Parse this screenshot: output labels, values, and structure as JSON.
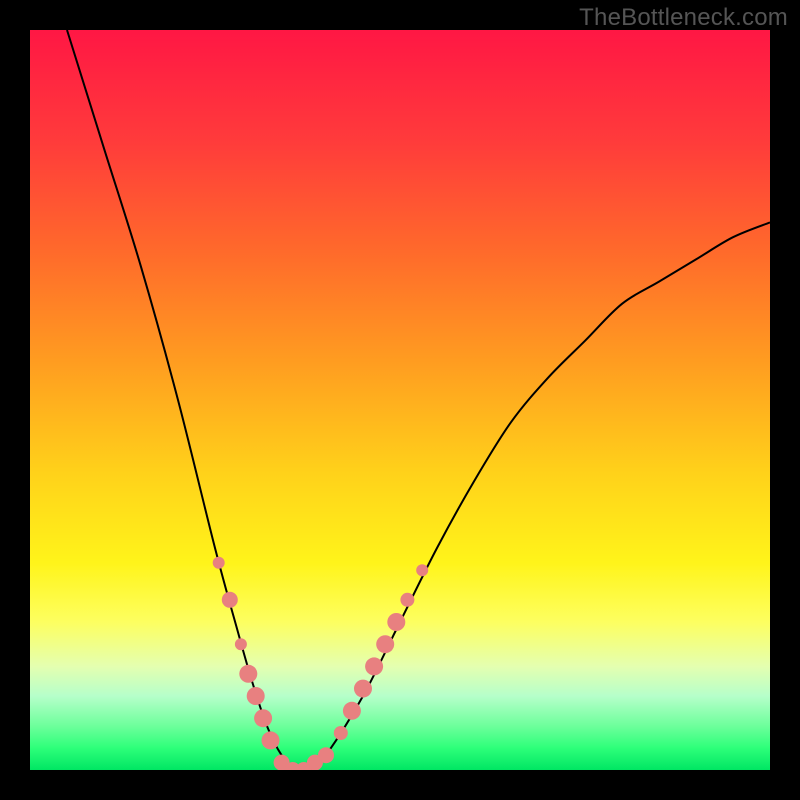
{
  "watermark": "TheBottleneck.com",
  "chart_data": {
    "type": "line",
    "title": "",
    "xlabel": "",
    "ylabel": "",
    "xlim": [
      0,
      100
    ],
    "ylim": [
      0,
      100
    ],
    "grid": false,
    "legend": false,
    "series": [
      {
        "name": "bottleneck-curve",
        "x": [
          5,
          10,
          15,
          20,
          25,
          28,
          30,
          32,
          34,
          36,
          38,
          40,
          45,
          50,
          55,
          60,
          65,
          70,
          75,
          80,
          85,
          90,
          95,
          100
        ],
        "y": [
          100,
          84,
          68,
          50,
          30,
          19,
          12,
          6,
          2,
          0,
          0,
          2,
          10,
          20,
          30,
          39,
          47,
          53,
          58,
          63,
          66,
          69,
          72,
          74
        ],
        "stroke": "#000000"
      }
    ],
    "markers": [
      {
        "name": "highlighted-points",
        "color": "#e88080",
        "points": [
          {
            "x": 25.5,
            "y": 28,
            "r": 6
          },
          {
            "x": 27.0,
            "y": 23,
            "r": 8
          },
          {
            "x": 28.5,
            "y": 17,
            "r": 6
          },
          {
            "x": 29.5,
            "y": 13,
            "r": 9
          },
          {
            "x": 30.5,
            "y": 10,
            "r": 9
          },
          {
            "x": 31.5,
            "y": 7,
            "r": 9
          },
          {
            "x": 32.5,
            "y": 4,
            "r": 9
          },
          {
            "x": 34.0,
            "y": 1,
            "r": 8
          },
          {
            "x": 35.5,
            "y": 0,
            "r": 8
          },
          {
            "x": 37.0,
            "y": 0,
            "r": 8
          },
          {
            "x": 38.5,
            "y": 1,
            "r": 8
          },
          {
            "x": 40.0,
            "y": 2,
            "r": 8
          },
          {
            "x": 42.0,
            "y": 5,
            "r": 7
          },
          {
            "x": 43.5,
            "y": 8,
            "r": 9
          },
          {
            "x": 45.0,
            "y": 11,
            "r": 9
          },
          {
            "x": 46.5,
            "y": 14,
            "r": 9
          },
          {
            "x": 48.0,
            "y": 17,
            "r": 9
          },
          {
            "x": 49.5,
            "y": 20,
            "r": 9
          },
          {
            "x": 51.0,
            "y": 23,
            "r": 7
          },
          {
            "x": 53.0,
            "y": 27,
            "r": 6
          }
        ]
      }
    ],
    "background_gradient": {
      "stops": [
        {
          "offset": 0.0,
          "color": "#ff1744"
        },
        {
          "offset": 0.15,
          "color": "#ff3b3b"
        },
        {
          "offset": 0.3,
          "color": "#ff6a2b"
        },
        {
          "offset": 0.45,
          "color": "#ff9d20"
        },
        {
          "offset": 0.6,
          "color": "#ffd21a"
        },
        {
          "offset": 0.72,
          "color": "#fff41a"
        },
        {
          "offset": 0.8,
          "color": "#fdff60"
        },
        {
          "offset": 0.86,
          "color": "#e4ffb0"
        },
        {
          "offset": 0.9,
          "color": "#b6ffca"
        },
        {
          "offset": 0.94,
          "color": "#6eff9c"
        },
        {
          "offset": 0.97,
          "color": "#2eff7a"
        },
        {
          "offset": 1.0,
          "color": "#00e663"
        }
      ]
    }
  }
}
